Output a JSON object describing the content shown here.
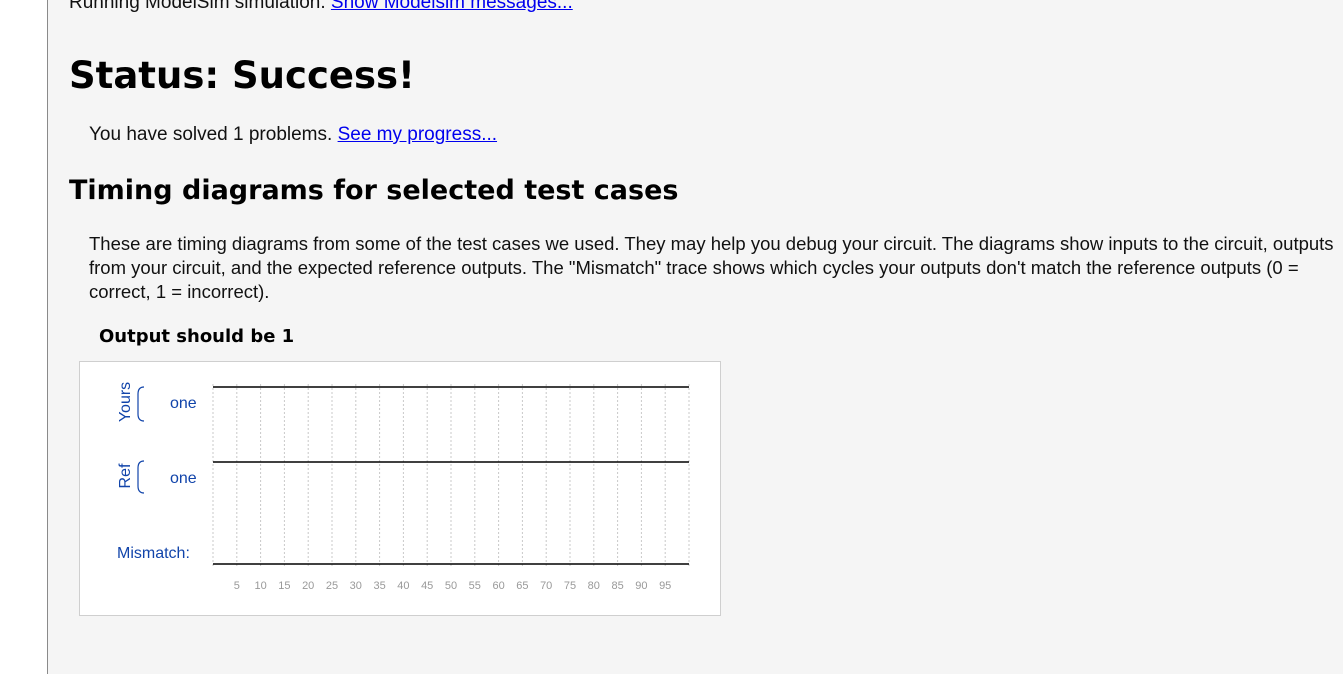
{
  "simulation": {
    "text": "Running ModelSim simulation.",
    "link": "Show Modelsim messages..."
  },
  "status": {
    "title": "Status: Success!"
  },
  "progress": {
    "text": "You have solved 1 problems.",
    "link": "See my progress..."
  },
  "timing": {
    "heading": "Timing diagrams for selected test cases",
    "description": "These are timing diagrams from some of the test cases we used. They may help you debug your circuit. The diagrams show inputs to the circuit, outputs from your circuit, and the expected reference outputs. The \"Mismatch\" trace shows which cycles your outputs don't match the reference outputs (0 = correct, 1 = incorrect)."
  },
  "test_case": {
    "title": "Output should be 1"
  },
  "diagram": {
    "group_yours": "Yours",
    "group_ref": "Ref",
    "signal_yours": "one",
    "signal_ref": "one",
    "mismatch_label": "Mismatch:",
    "ticks": [
      "5",
      "10",
      "15",
      "20",
      "25",
      "30",
      "35",
      "40",
      "45",
      "50",
      "55",
      "60",
      "65",
      "70",
      "75",
      "80",
      "85",
      "90",
      "95"
    ],
    "colors": {
      "label": "#1144aa",
      "grid": "#c8c8c8",
      "trace": "#000000",
      "tick": "#999999"
    }
  },
  "chart_data": {
    "type": "line",
    "x": [
      0,
      100
    ],
    "xlim": [
      0,
      100
    ],
    "x_ticks": [
      5,
      10,
      15,
      20,
      25,
      30,
      35,
      40,
      45,
      50,
      55,
      60,
      65,
      70,
      75,
      80,
      85,
      90,
      95
    ],
    "series": [
      {
        "name": "one",
        "group": "Yours",
        "values": [
          1,
          1
        ]
      },
      {
        "name": "one",
        "group": "Ref",
        "values": [
          1,
          1
        ]
      },
      {
        "name": "Mismatch:",
        "values": [
          0,
          0
        ]
      }
    ]
  }
}
